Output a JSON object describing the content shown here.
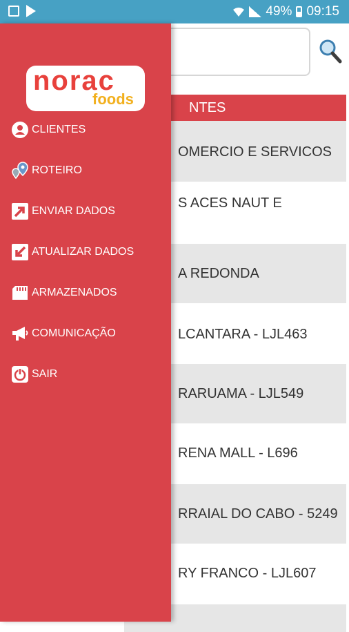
{
  "status_bar": {
    "battery": "49%",
    "time": "09:15"
  },
  "search": {
    "value": ""
  },
  "list": {
    "header": "NTES",
    "rows": [
      "OMERCIO E SERVICOS",
      "S ACES NAUT E",
      "A REDONDA",
      "LCANTARA - LJL463",
      "RARUAMA - LJL549",
      "RENA MALL - L696",
      "RRAIAL DO CABO - 5249",
      "RY FRANCO - LJL607",
      ""
    ]
  },
  "logo": {
    "brand": "norac",
    "sub": "foods"
  },
  "menu": [
    {
      "label": "CLIENTES",
      "icon": "user-icon"
    },
    {
      "label": "ROTEIRO",
      "icon": "map-pin-icon"
    },
    {
      "label": "ENVIAR DADOS",
      "icon": "upload-arrow-icon"
    },
    {
      "label": "ATUALIZAR DADOS",
      "icon": "download-arrow-icon"
    },
    {
      "label": "ARMAZENADOS",
      "icon": "storage-card-icon"
    },
    {
      "label": "COMUNICAÇÃO",
      "icon": "megaphone-icon"
    },
    {
      "label": "SAIR",
      "icon": "power-icon"
    }
  ]
}
